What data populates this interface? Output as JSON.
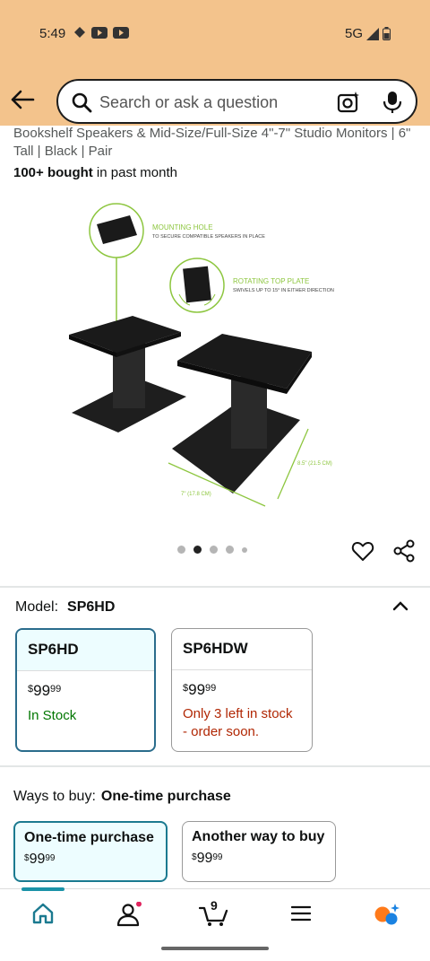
{
  "status": {
    "time": "5:49",
    "network": "5G"
  },
  "search": {
    "placeholder": "Search or ask a question"
  },
  "product": {
    "title_line": "Bookshelf Speakers & Mid-Size/Full-Size 4\"-7\" Studio Monitors | 6\" Tall | Black | Pair",
    "bought_strong": "100+ bought",
    "bought_rest": " in past month",
    "image_callouts": {
      "mounting_hole_title": "MOUNTING HOLE",
      "mounting_hole_desc": "TO SECURE COMPATIBLE SPEAKERS IN PLACE",
      "rotating_title": "ROTATING TOP PLATE",
      "rotating_desc": "SWIVELS UP TO 15° IN EITHER DIRECTION",
      "dim_width": "7\" (17.8 CM)",
      "dim_depth": "8.5\" (21.5 CM)"
    }
  },
  "model": {
    "label": "Model:",
    "value": "SP6HD",
    "options": [
      {
        "name": "SP6HD",
        "price_dollars": "99",
        "price_cents": "99",
        "stock": "In Stock"
      },
      {
        "name": "SP6HDW",
        "price_dollars": "99",
        "price_cents": "99",
        "stock_line1": "Only 3 left in stock",
        "stock_line2": "- order soon."
      }
    ]
  },
  "ways_to_buy": {
    "label": "Ways to buy:",
    "value": "One-time purchase",
    "options": [
      {
        "title": "One-time purchase",
        "price_dollars": "99",
        "price_cents": "99"
      },
      {
        "title": "Another way to buy",
        "price_dollars": "99",
        "price_cents": "99"
      }
    ]
  },
  "nav": {
    "cart_count": "9",
    "items": [
      "home-icon",
      "account-icon",
      "cart-icon",
      "menu-icon",
      "rufus-icon"
    ]
  },
  "colors": {
    "header": "#f3c38c",
    "accent": "#1b93a8",
    "selected_border": "#2a6c8c",
    "in_stock": "#007600",
    "low_stock": "#b12704",
    "callout_green": "#8dc63f"
  }
}
